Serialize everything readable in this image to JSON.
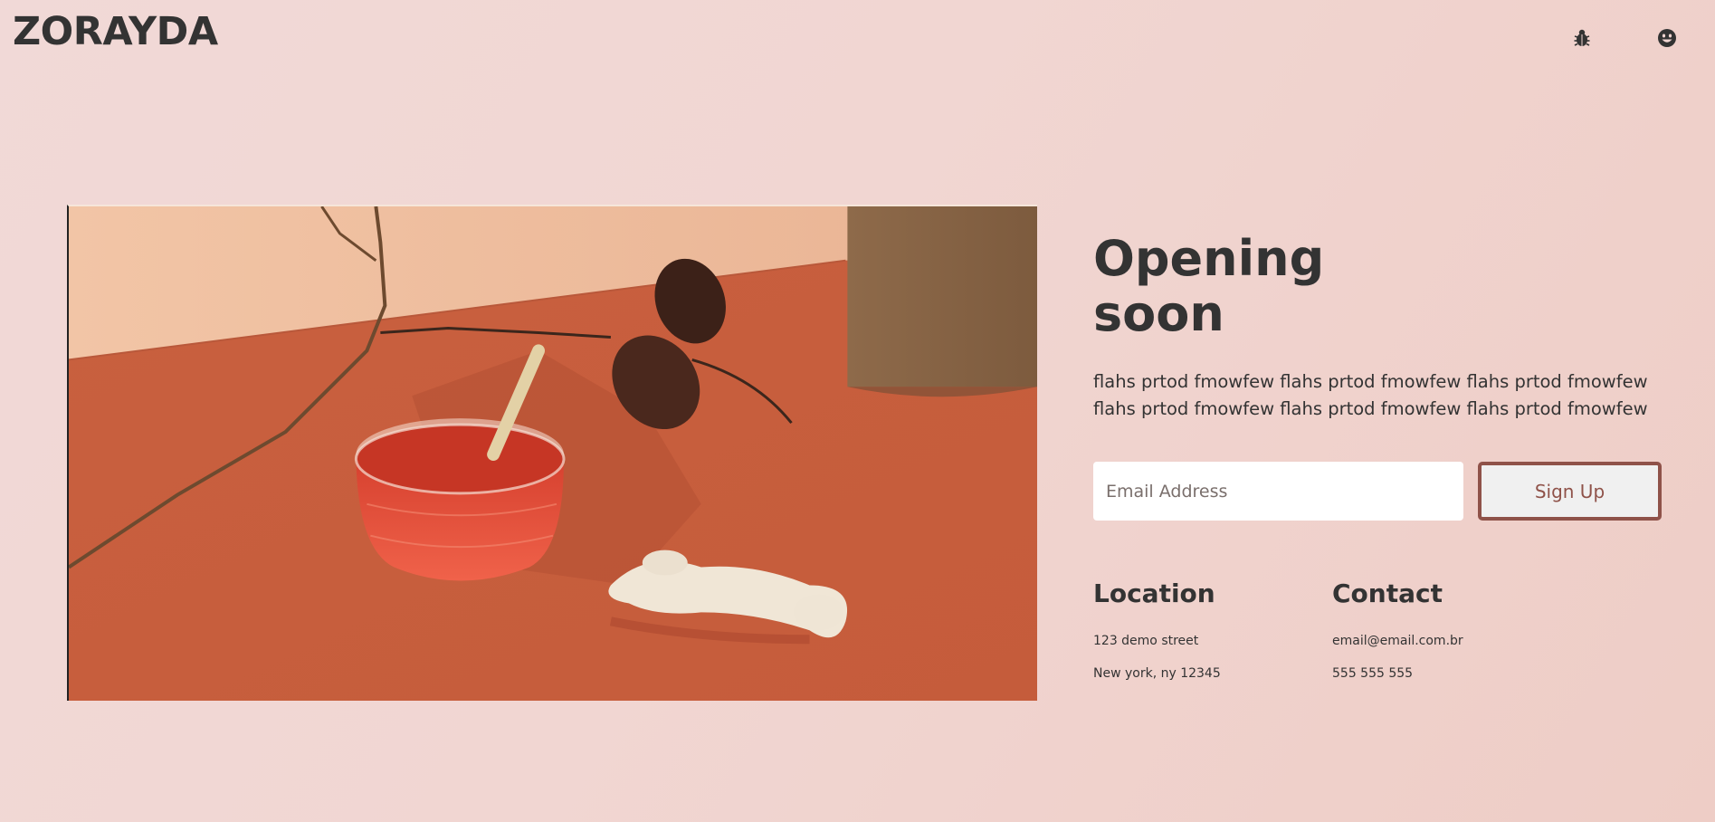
{
  "header": {
    "logo": "ZORAYDA",
    "icons": [
      "bug-icon",
      "smiley-icon"
    ]
  },
  "hero": {
    "image_alt": "Glass of red juice with straw, branch and ginger root on terracotta surface",
    "title": "Opening soon",
    "description": "flahs prtod fmowfew flahs prtod fmowfew flahs prtod fmowfew flahs prtod fmowfew flahs prtod fmowfew flahs prtod fmowfew"
  },
  "signup": {
    "email_placeholder": "Email Address",
    "button_label": "Sign Up"
  },
  "location": {
    "heading": "Location",
    "line1": "123 demo street",
    "line2": "New york, ny 12345"
  },
  "contact": {
    "heading": "Contact",
    "email": "email@email.com.br",
    "phone": "555 555 555"
  },
  "colors": {
    "background": "#f1d6d2",
    "text": "#333333",
    "button_border": "#8f5249",
    "button_bg": "#f0f0f0"
  }
}
